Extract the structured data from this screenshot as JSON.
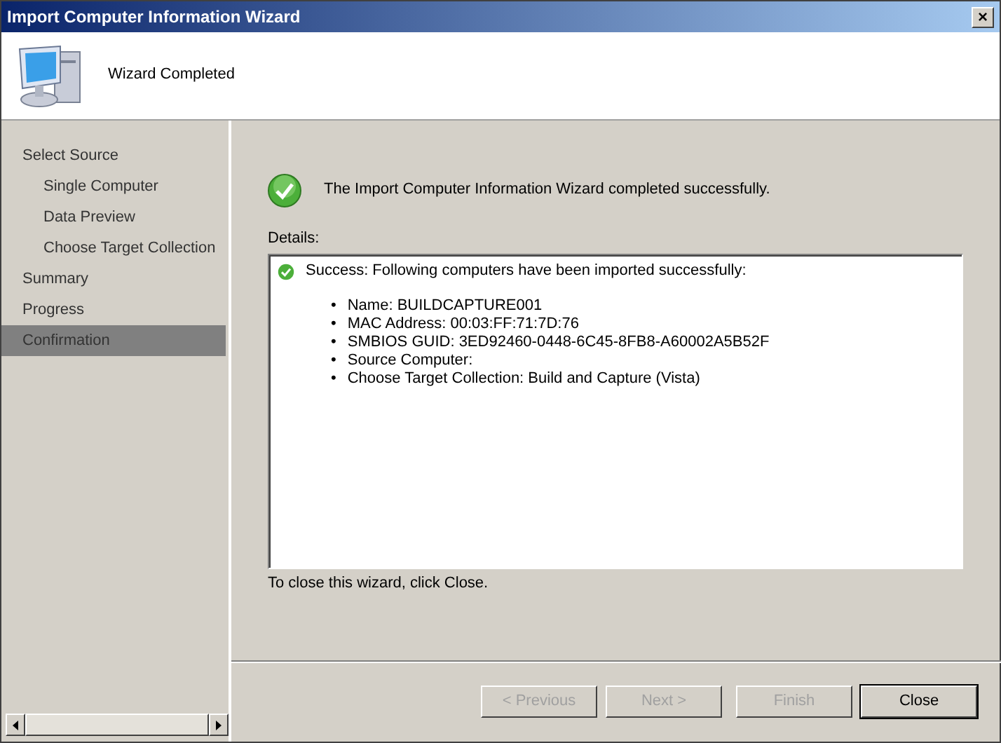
{
  "window": {
    "title": "Import Computer Information Wizard",
    "close_label": "×"
  },
  "header": {
    "title": "Wizard Completed"
  },
  "sidebar": {
    "items": [
      {
        "label": "Select Source",
        "selected": false,
        "children": [
          {
            "label": "Single Computer",
            "selected": false
          },
          {
            "label": "Data Preview",
            "selected": false
          },
          {
            "label": "Choose Target Collection",
            "selected": false
          }
        ]
      },
      {
        "label": "Summary",
        "selected": false
      },
      {
        "label": "Progress",
        "selected": false
      },
      {
        "label": "Confirmation",
        "selected": true
      }
    ]
  },
  "content": {
    "message": "The Import Computer Information Wizard completed successfully.",
    "details_label": "Details:",
    "details": {
      "bullet": "•",
      "heading": "Success: Following computers have been imported successfully:",
      "items": [
        "Name: BUILDCAPTURE001",
        "MAC Address: 00:03:FF:71:7D:76",
        "SMBIOS GUID: 3ED92460-0448-6C45-8FB8-A60002A5B52F",
        "Source Computer:",
        "Choose Target Collection: Build and Capture (Vista)"
      ]
    },
    "hint": "To close this wizard, click Close."
  },
  "buttons": [
    {
      "label": "< Previous",
      "disabled": true,
      "default": false
    },
    {
      "label": "Next >",
      "disabled": true,
      "default": false
    },
    {
      "label": "Finish",
      "disabled": true,
      "default": false
    },
    {
      "label": "Close",
      "disabled": false,
      "default": true
    }
  ]
}
